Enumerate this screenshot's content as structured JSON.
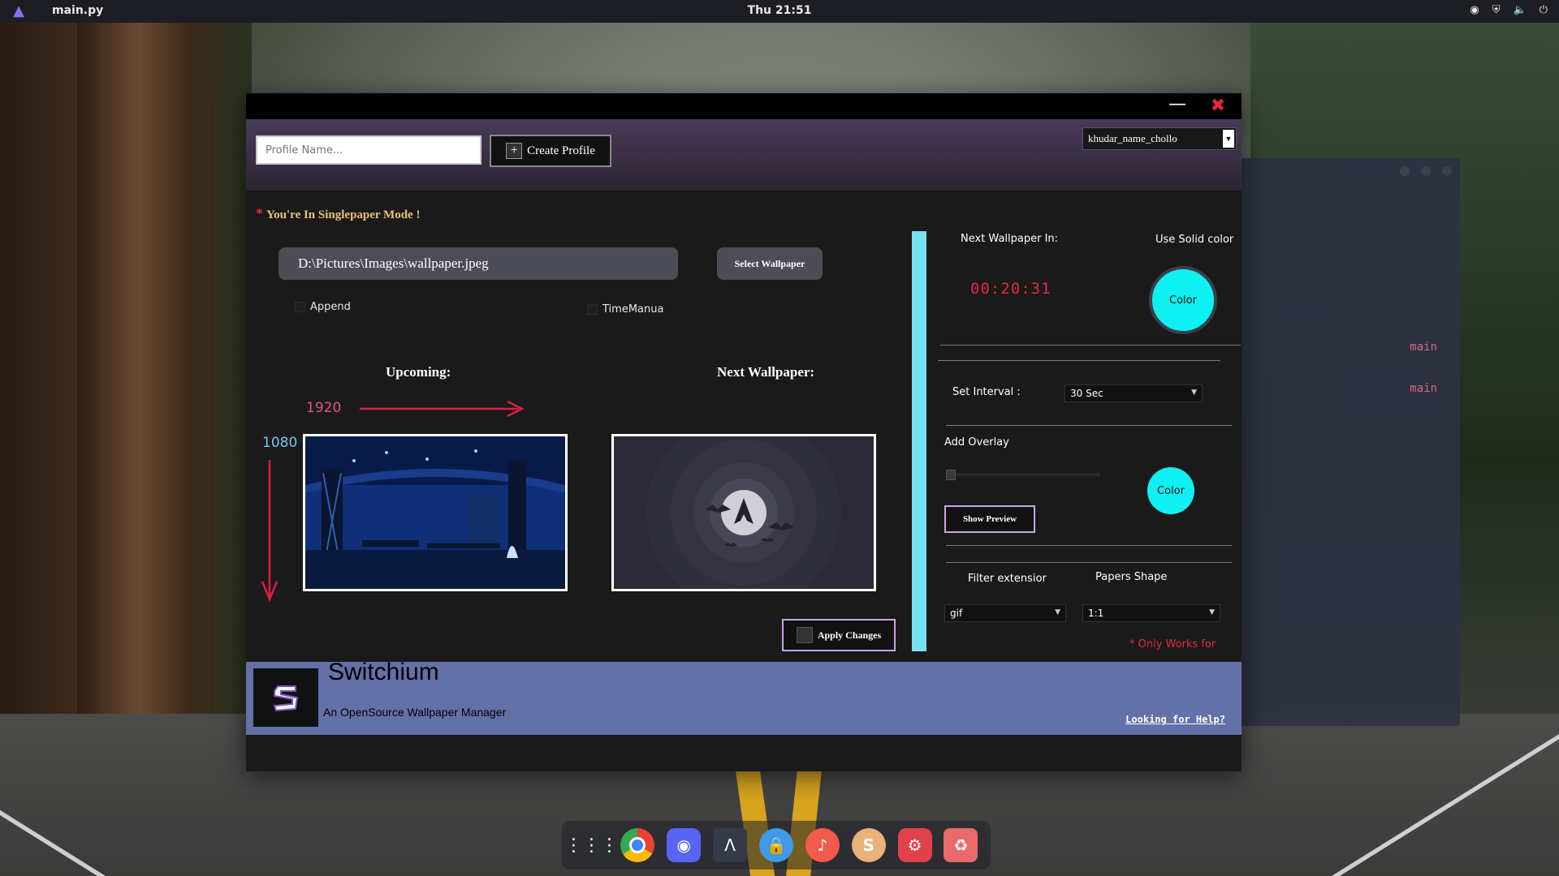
{
  "topbar": {
    "app_name": "main.py",
    "clock": "Thu 21:51",
    "tray": [
      "discord-icon",
      "shield-icon",
      "volume-icon",
      "power-icon"
    ]
  },
  "bg_terminal": {
    "lines": [
      "main",
      "main"
    ]
  },
  "window": {
    "minimize_symbol": "—",
    "close_symbol": "✖"
  },
  "header": {
    "profile_placeholder": "Profile Name...",
    "create_profile_label": "Create Profile",
    "profile_selected": "khudar_name_chollo"
  },
  "main": {
    "mode_note": "You're In Singlepaper Mode !",
    "wallpaper_path": "D:\\Pictures\\Images\\wallpaper.jpeg",
    "select_wallpaper_label": "Select Wallpaper",
    "append_label": "Append",
    "time_manual_label": "TimeManua",
    "upcoming_label": "Upcoming:",
    "next_wallpaper_label": "Next Wallpaper:",
    "width_label": "1920",
    "height_label": "1080",
    "apply_label": "Apply Changes"
  },
  "right_panel": {
    "next_in_label": "Next Wallpaper In:",
    "solid_color_label": "Use Solid color",
    "timer": "00:20:31",
    "color_label": "Color",
    "interval_label": "Set Interval :",
    "interval_value": "30 Sec",
    "overlay_label": "Add Overlay",
    "overlay_color_label": "Color",
    "show_preview_label": "Show Preview",
    "filter_label": "Filter extensior",
    "shape_label": "Papers Shape",
    "filter_value": "gif",
    "shape_value": "1:1",
    "only_works": "* Only Works for"
  },
  "footer": {
    "app_name": "Switchium",
    "tagline": "An OpenSource Wallpaper Manager",
    "help_link": "Looking for Help?"
  },
  "colors": {
    "accent_cyan": "#0ff0f2",
    "red": "#e22b37",
    "footer_bg": "#6470a8",
    "purple_border": "#c9a5e6"
  },
  "dock": [
    "apps-grid-icon",
    "chrome-icon",
    "discord-icon",
    "arch-icon",
    "lock-app-icon",
    "music-icon",
    "switchium-icon",
    "settings-icon",
    "trash-icon"
  ]
}
